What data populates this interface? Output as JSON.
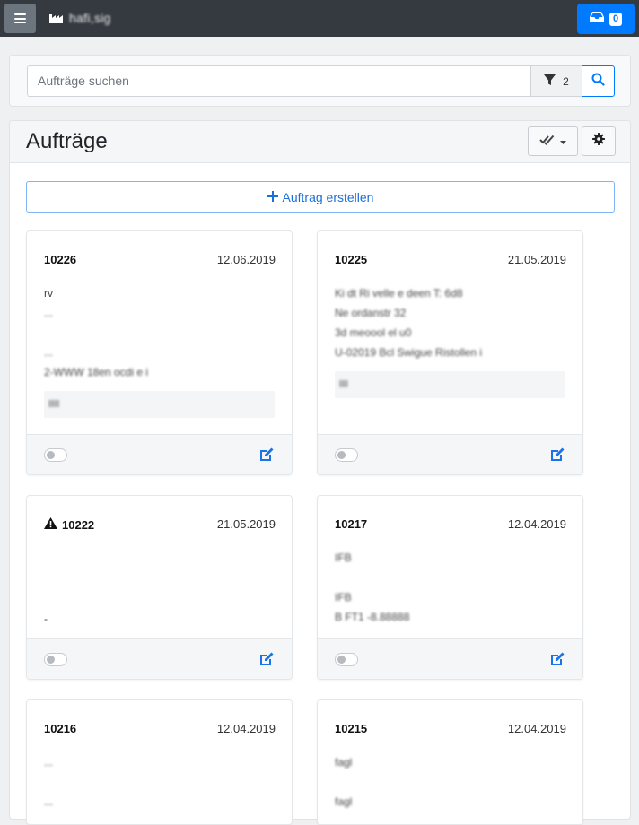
{
  "navbar": {
    "brand": "hafi,sig",
    "inbox_count": "0"
  },
  "search": {
    "placeholder": "Aufträge suchen",
    "filter_count": "2"
  },
  "main": {
    "title": "Aufträge",
    "create_label": "Auftrag erstellen"
  },
  "orders": [
    {
      "id": "10226",
      "date": "12.06.2019",
      "lines": [
        "rv",
        "...",
        "",
        "...",
        "2-WWW 18en ocdi e i"
      ],
      "note": "lllll",
      "warning": false
    },
    {
      "id": "10225",
      "date": "21.05.2019",
      "lines": [
        "Ki dt Ri velle e deen T: 6d8",
        "Ne ordanstr 32",
        "3d meoool el u0",
        "U-02019 Bcl Swigue Ristollen i"
      ],
      "note": "llll",
      "warning": false
    },
    {
      "id": "10222",
      "date": "21.05.2019",
      "lines": [
        "",
        "",
        "",
        "-"
      ],
      "note": "",
      "warning": true
    },
    {
      "id": "10217",
      "date": "12.04.2019",
      "lines": [
        "IFB",
        "",
        "IFB",
        "B FT1 -8.88888"
      ],
      "note": "",
      "warning": false
    },
    {
      "id": "10216",
      "date": "12.04.2019",
      "lines": [
        "...",
        "",
        "..."
      ],
      "note": "",
      "warning": false
    },
    {
      "id": "10215",
      "date": "12.04.2019",
      "lines": [
        "fagl",
        "",
        "fagl"
      ],
      "note": "",
      "warning": false
    }
  ],
  "colors": {
    "primary": "#007bff",
    "navbar": "#343a40",
    "header_bg": "#f5f6f7"
  }
}
